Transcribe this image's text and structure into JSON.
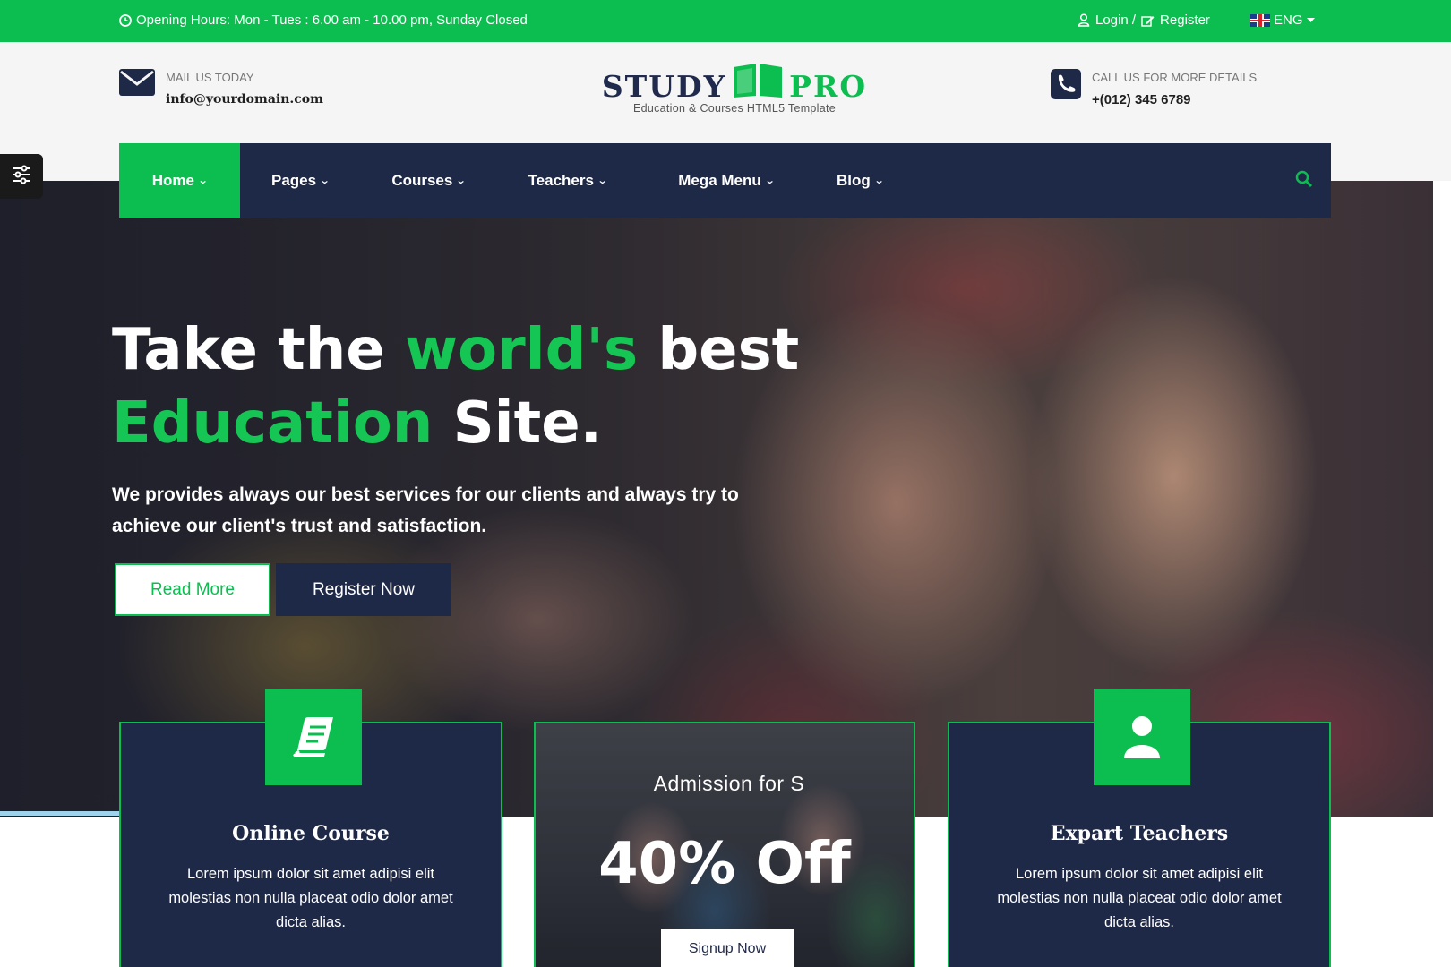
{
  "topbar": {
    "hours": "Opening Hours: Mon - Tues : 6.00 am - 10.00 pm, Sunday Closed",
    "login": "Login /",
    "register": "Register",
    "language": "ENG"
  },
  "header": {
    "mail_label": "MAIL US TODAY",
    "mail_value": "info@yourdomain.com",
    "phone_label": "CALL US FOR MORE DETAILS",
    "phone_value": "+(012) 345 6789",
    "logo_study": "STUDY",
    "logo_pro": "PRO",
    "logo_tagline": "Education & Courses HTML5 Template"
  },
  "nav": {
    "items": [
      {
        "label": "Home"
      },
      {
        "label": "Pages"
      },
      {
        "label": "Courses"
      },
      {
        "label": "Teachers"
      },
      {
        "label": "Mega Menu"
      },
      {
        "label": "Blog"
      }
    ]
  },
  "hero": {
    "title_part1": "Take the ",
    "title_green1": "world's",
    "title_part2": " best",
    "title_green2": "Education",
    "title_part3": " Site.",
    "subtitle": "We provides always our best services for our clients and always try to achieve our client's trust and satisfaction.",
    "read_more": "Read More",
    "register_now": "Register Now"
  },
  "features": {
    "online": {
      "title": "Online Course",
      "text": "Lorem ipsum dolor sit amet adipisi elit molestias non nulla placeat odio dolor amet dicta alias."
    },
    "promo": {
      "admission": "Admission for S",
      "discount": "40% Off",
      "signup": "Signup Now"
    },
    "teachers": {
      "title": "Expart Teachers",
      "text": "Lorem ipsum dolor sit amet adipisi elit molestias non nulla placeat odio dolor amet dicta alias."
    }
  },
  "colors": {
    "accent": "#0cbe4f",
    "navy": "#1e2847"
  },
  "icons": [
    "clock-icon",
    "user-icon",
    "edit-icon",
    "uk-flag-icon",
    "envelope-icon",
    "phone-icon",
    "book-logo-icon",
    "search-icon",
    "settings-sliders-icon",
    "book-icon",
    "person-icon"
  ]
}
